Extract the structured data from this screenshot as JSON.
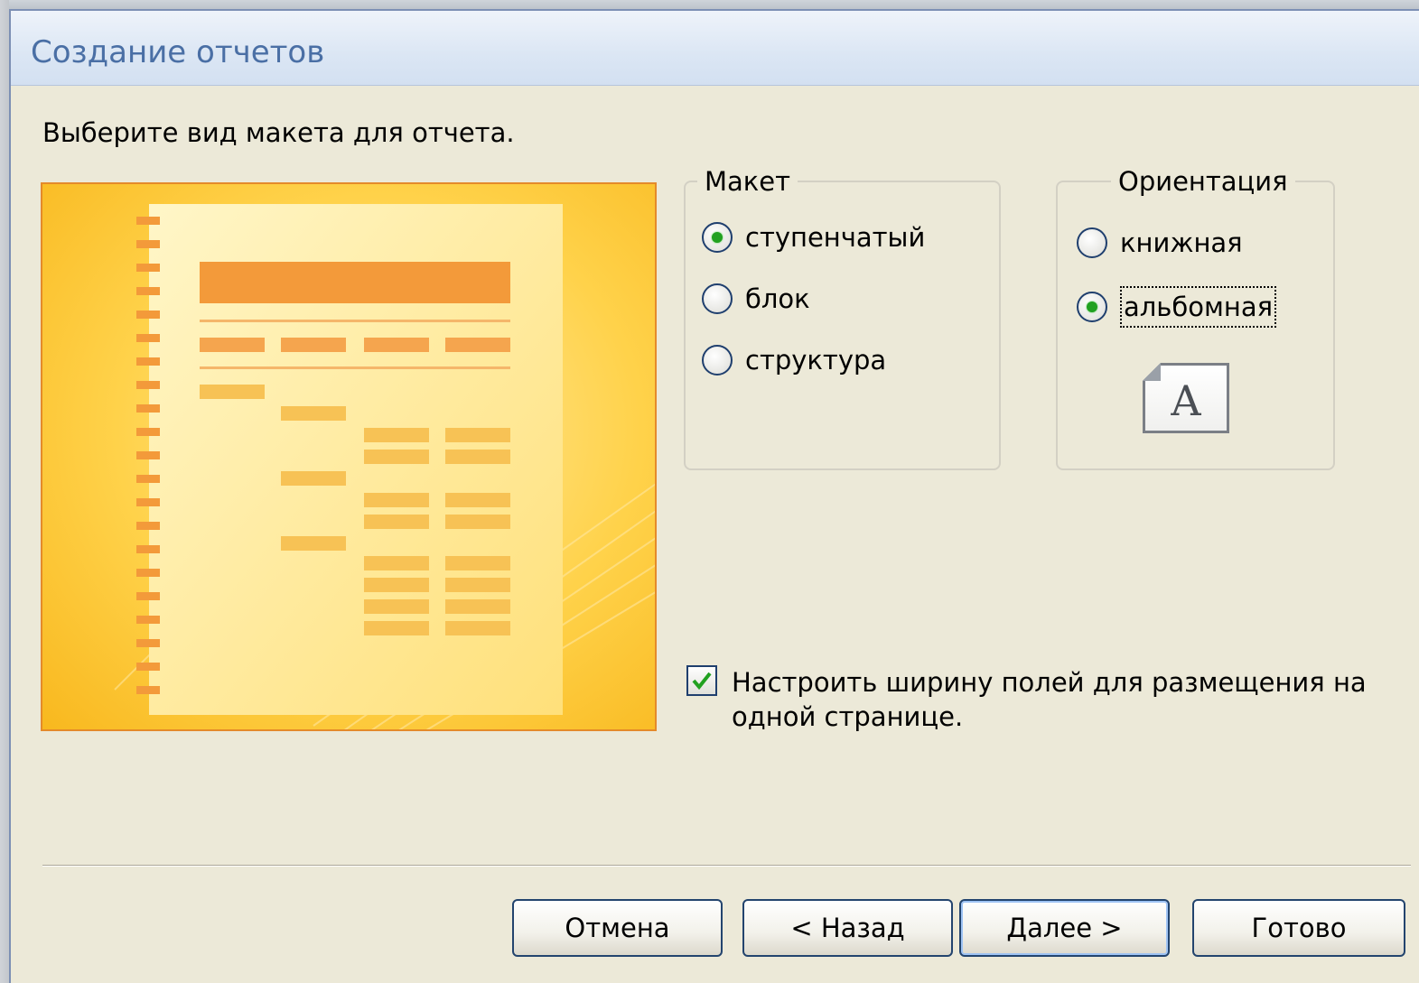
{
  "window": {
    "title": "Создание отчетов"
  },
  "prompt": "Выберите вид макета для отчета.",
  "layout_group": {
    "legend": "Макет",
    "options": [
      {
        "label": "ступенчатый",
        "selected": true
      },
      {
        "label": "блок",
        "selected": false
      },
      {
        "label": "структура",
        "selected": false
      }
    ]
  },
  "orientation_group": {
    "legend": "Ориентация",
    "options": [
      {
        "label": "книжная",
        "selected": false
      },
      {
        "label": "альбомная",
        "selected": true
      }
    ],
    "icon_letter": "A"
  },
  "fit_checkbox": {
    "checked": true,
    "label": "Настроить ширину полей для размещения на одной странице."
  },
  "buttons": {
    "cancel": "Отмена",
    "back": "< Назад",
    "next": "Далее >",
    "finish": "Готово"
  },
  "colors": {
    "accent_title": "#4a6fa5",
    "preview_orange": "#f39a3a",
    "radio_selected": "#21a121"
  }
}
